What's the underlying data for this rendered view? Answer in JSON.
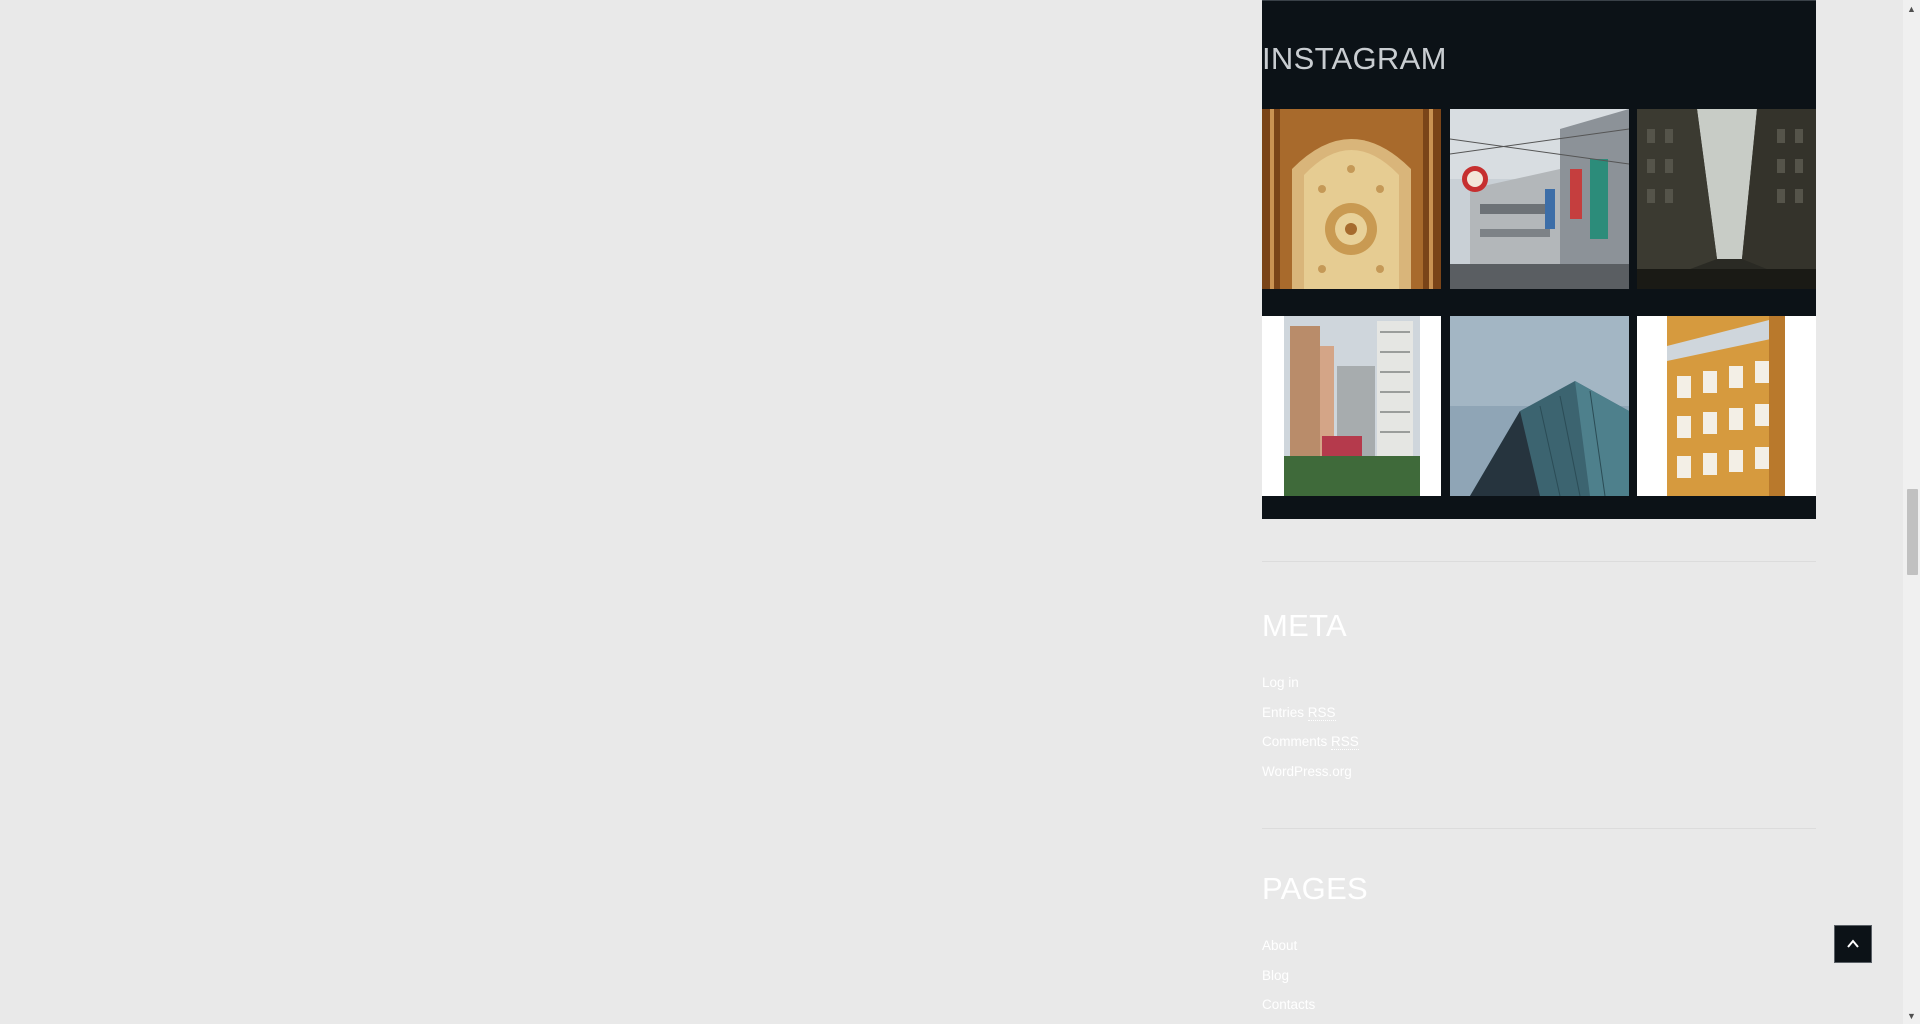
{
  "instagram": {
    "title": "INSTAGRAM",
    "images": [
      {
        "subject": "ornate carved wooden door"
      },
      {
        "subject": "street with shop signs"
      },
      {
        "subject": "narrow city street between buildings"
      },
      {
        "subject": "residential high-rise towers"
      },
      {
        "subject": "glass skyscraper against sky"
      },
      {
        "subject": "orange historic building facade"
      }
    ]
  },
  "meta": {
    "title": "META",
    "items": [
      {
        "label": "Log in",
        "abbr": ""
      },
      {
        "label": "Entries ",
        "abbr": "RSS"
      },
      {
        "label": "Comments ",
        "abbr": "RSS"
      },
      {
        "label": "WordPress.org",
        "abbr": ""
      }
    ]
  },
  "pages": {
    "title": "PAGES",
    "items": [
      {
        "label": "About"
      },
      {
        "label": "Blog"
      },
      {
        "label": "Contacts"
      }
    ]
  },
  "icons": {
    "back_to_top": "chevron-up-icon",
    "scroll_up": "triangle-up-icon",
    "scroll_down": "triangle-down-icon"
  },
  "colors": {
    "page_background": "#e9e9e9",
    "widget_dark": "#0c1217",
    "text": "#ffffff"
  }
}
